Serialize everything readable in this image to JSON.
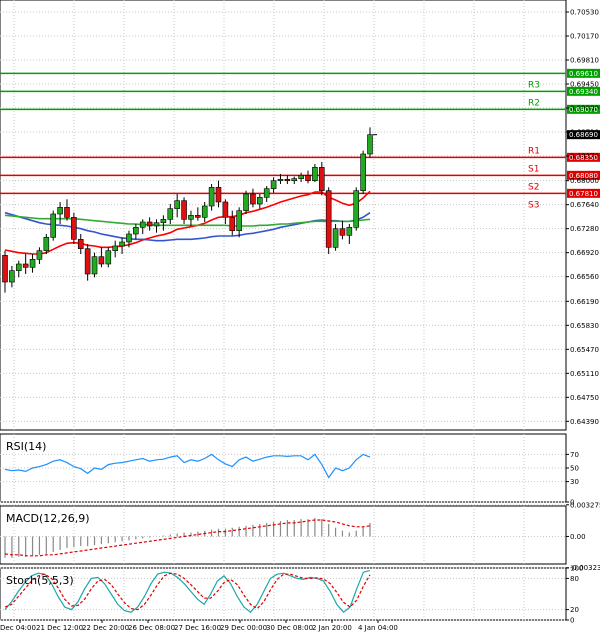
{
  "chart_data": [
    {
      "type": "candlestick",
      "panel": "price",
      "ylim": [
        0.6426,
        0.7071
      ],
      "y_ticks": [
        0.7053,
        0.7017,
        0.6981,
        0.6945,
        0.6909,
        0.6873,
        0.6837,
        0.68,
        0.6764,
        0.6728,
        0.6692,
        0.6656,
        0.6619,
        0.6583,
        0.6547,
        0.6511,
        0.6475,
        0.6439
      ],
      "y_tick_labels": [
        "0.70530",
        "0.70170",
        "0.69810",
        "0.69450",
        "0.69090",
        "0.68730",
        "0.68370",
        "0.68000",
        "0.67640",
        "0.67280",
        "0.66920",
        "0.66560",
        "0.66190",
        "0.65830",
        "0.65470",
        "0.65110",
        "0.64750",
        "0.64390"
      ],
      "x_labels": [
        "Dec 04:00",
        "21 Dec 12:00",
        "22 Dec 20:00",
        "26 Dec 08:00",
        "27 Dec 16:00",
        "29 Dec 00:00",
        "30 Dec 08:00",
        "2 Jan 20:00",
        "4 Jan 04:00"
      ],
      "candles": [
        {
          "o": 0.6688,
          "h": 0.6695,
          "l": 0.6632,
          "c": 0.6648
        },
        {
          "o": 0.6648,
          "h": 0.6672,
          "l": 0.664,
          "c": 0.6665
        },
        {
          "o": 0.6665,
          "h": 0.668,
          "l": 0.6655,
          "c": 0.6675
        },
        {
          "o": 0.6675,
          "h": 0.669,
          "l": 0.666,
          "c": 0.667
        },
        {
          "o": 0.667,
          "h": 0.669,
          "l": 0.6662,
          "c": 0.6682
        },
        {
          "o": 0.6682,
          "h": 0.67,
          "l": 0.6675,
          "c": 0.6695
        },
        {
          "o": 0.6695,
          "h": 0.672,
          "l": 0.669,
          "c": 0.6715
        },
        {
          "o": 0.6715,
          "h": 0.6755,
          "l": 0.671,
          "c": 0.675
        },
        {
          "o": 0.675,
          "h": 0.6768,
          "l": 0.6735,
          "c": 0.676
        },
        {
          "o": 0.676,
          "h": 0.6772,
          "l": 0.674,
          "c": 0.6745
        },
        {
          "o": 0.6745,
          "h": 0.6752,
          "l": 0.6705,
          "c": 0.6712
        },
        {
          "o": 0.6712,
          "h": 0.672,
          "l": 0.669,
          "c": 0.6698
        },
        {
          "o": 0.6698,
          "h": 0.6705,
          "l": 0.665,
          "c": 0.666
        },
        {
          "o": 0.666,
          "h": 0.6692,
          "l": 0.6655,
          "c": 0.6686
        },
        {
          "o": 0.6686,
          "h": 0.67,
          "l": 0.667,
          "c": 0.6675
        },
        {
          "o": 0.6675,
          "h": 0.67,
          "l": 0.667,
          "c": 0.6695
        },
        {
          "o": 0.6695,
          "h": 0.671,
          "l": 0.6685,
          "c": 0.6702
        },
        {
          "o": 0.6702,
          "h": 0.6715,
          "l": 0.669,
          "c": 0.6708
        },
        {
          "o": 0.6708,
          "h": 0.6725,
          "l": 0.67,
          "c": 0.672
        },
        {
          "o": 0.672,
          "h": 0.6735,
          "l": 0.6712,
          "c": 0.673
        },
        {
          "o": 0.673,
          "h": 0.6742,
          "l": 0.672,
          "c": 0.6738
        },
        {
          "o": 0.6738,
          "h": 0.6745,
          "l": 0.6725,
          "c": 0.6732
        },
        {
          "o": 0.6732,
          "h": 0.6742,
          "l": 0.6722,
          "c": 0.6737
        },
        {
          "o": 0.6737,
          "h": 0.6748,
          "l": 0.6725,
          "c": 0.6742
        },
        {
          "o": 0.6742,
          "h": 0.6765,
          "l": 0.6735,
          "c": 0.6758
        },
        {
          "o": 0.6758,
          "h": 0.678,
          "l": 0.6745,
          "c": 0.677
        },
        {
          "o": 0.677,
          "h": 0.6775,
          "l": 0.6735,
          "c": 0.6742
        },
        {
          "o": 0.6742,
          "h": 0.6755,
          "l": 0.6732,
          "c": 0.6748
        },
        {
          "o": 0.6748,
          "h": 0.676,
          "l": 0.674,
          "c": 0.6745
        },
        {
          "o": 0.6745,
          "h": 0.6768,
          "l": 0.6738,
          "c": 0.6762
        },
        {
          "o": 0.6762,
          "h": 0.6795,
          "l": 0.6755,
          "c": 0.679
        },
        {
          "o": 0.679,
          "h": 0.68,
          "l": 0.676,
          "c": 0.6768
        },
        {
          "o": 0.6768,
          "h": 0.6772,
          "l": 0.6735,
          "c": 0.6745
        },
        {
          "o": 0.6745,
          "h": 0.6755,
          "l": 0.6718,
          "c": 0.6725
        },
        {
          "o": 0.6725,
          "h": 0.676,
          "l": 0.6715,
          "c": 0.6755
        },
        {
          "o": 0.6755,
          "h": 0.6785,
          "l": 0.675,
          "c": 0.678
        },
        {
          "o": 0.678,
          "h": 0.6788,
          "l": 0.676,
          "c": 0.6765
        },
        {
          "o": 0.6765,
          "h": 0.678,
          "l": 0.6758,
          "c": 0.6775
        },
        {
          "o": 0.6775,
          "h": 0.6792,
          "l": 0.6768,
          "c": 0.6788
        },
        {
          "o": 0.6788,
          "h": 0.6805,
          "l": 0.6782,
          "c": 0.68
        },
        {
          "o": 0.68,
          "h": 0.681,
          "l": 0.6795,
          "c": 0.6802
        },
        {
          "o": 0.6802,
          "h": 0.6808,
          "l": 0.6795,
          "c": 0.68
        },
        {
          "o": 0.68,
          "h": 0.6806,
          "l": 0.6795,
          "c": 0.6803
        },
        {
          "o": 0.6803,
          "h": 0.6812,
          "l": 0.6798,
          "c": 0.6808
        },
        {
          "o": 0.6808,
          "h": 0.6815,
          "l": 0.6796,
          "c": 0.68
        },
        {
          "o": 0.68,
          "h": 0.6825,
          "l": 0.6798,
          "c": 0.682
        },
        {
          "o": 0.682,
          "h": 0.6828,
          "l": 0.6778,
          "c": 0.6785
        },
        {
          "o": 0.6785,
          "h": 0.679,
          "l": 0.669,
          "c": 0.67
        },
        {
          "o": 0.67,
          "h": 0.6735,
          "l": 0.6695,
          "c": 0.6728
        },
        {
          "o": 0.6728,
          "h": 0.674,
          "l": 0.6712,
          "c": 0.6718
        },
        {
          "o": 0.6718,
          "h": 0.6735,
          "l": 0.6705,
          "c": 0.673
        },
        {
          "o": 0.673,
          "h": 0.679,
          "l": 0.6725,
          "c": 0.6785
        },
        {
          "o": 0.6785,
          "h": 0.6845,
          "l": 0.678,
          "c": 0.684
        },
        {
          "o": 0.684,
          "h": 0.688,
          "l": 0.6835,
          "c": 0.6869
        }
      ],
      "moving_averages": [
        {
          "color": "#ff0000",
          "values": [
            0.6696,
            0.6694,
            0.6692,
            0.6691,
            0.669,
            0.669,
            0.6692,
            0.6697,
            0.6702,
            0.6706,
            0.6707,
            0.6706,
            0.6703,
            0.6702,
            0.67,
            0.67,
            0.6701,
            0.6702,
            0.6704,
            0.6707,
            0.6711,
            0.6714,
            0.6717,
            0.6719,
            0.6722,
            0.6727,
            0.6729,
            0.6731,
            0.6733,
            0.6736,
            0.6741,
            0.6745,
            0.6746,
            0.6746,
            0.6748,
            0.6752,
            0.6754,
            0.6757,
            0.676,
            0.6764,
            0.6768,
            0.6771,
            0.6774,
            0.6777,
            0.6779,
            0.6783,
            0.6783,
            0.6775,
            0.6771,
            0.6766,
            0.6763,
            0.6766,
            0.6774,
            0.6784
          ]
        },
        {
          "color": "#3355cc",
          "values": [
            0.6752,
            0.6749,
            0.6746,
            0.6743,
            0.674,
            0.6737,
            0.6735,
            0.6734,
            0.6733,
            0.6732,
            0.673,
            0.6728,
            0.6725,
            0.6723,
            0.672,
            0.6718,
            0.6716,
            0.6714,
            0.6713,
            0.6712,
            0.6712,
            0.6711,
            0.671,
            0.671,
            0.6711,
            0.6712,
            0.6712,
            0.6712,
            0.6713,
            0.6714,
            0.6716,
            0.6717,
            0.6717,
            0.6717,
            0.6718,
            0.672,
            0.6721,
            0.6723,
            0.6725,
            0.6727,
            0.673,
            0.6732,
            0.6734,
            0.6736,
            0.6738,
            0.674,
            0.6741,
            0.674,
            0.674,
            0.6739,
            0.6739,
            0.6741,
            0.6745,
            0.6752
          ]
        },
        {
          "color": "#33aa33",
          "values": [
            0.6748,
            0.6747,
            0.6746,
            0.6745,
            0.6744,
            0.6743,
            0.6743,
            0.6743,
            0.6743,
            0.6743,
            0.6743,
            0.6742,
            0.6741,
            0.674,
            0.6739,
            0.6738,
            0.6737,
            0.6736,
            0.6735,
            0.6735,
            0.6734,
            0.6734,
            0.6733,
            0.6733,
            0.6733,
            0.6733,
            0.6733,
            0.6733,
            0.6733,
            0.6733,
            0.6733,
            0.6733,
            0.6733,
            0.6732,
            0.6732,
            0.6732,
            0.6732,
            0.6733,
            0.6733,
            0.6734,
            0.6735,
            0.6735,
            0.6736,
            0.6737,
            0.6738,
            0.6739,
            0.6739,
            0.6739,
            0.6739,
            0.6739,
            0.6739,
            0.674,
            0.6741,
            0.6742
          ]
        }
      ],
      "levels": [
        {
          "label": "",
          "value": 0.6961,
          "value_label": "0.69610",
          "color": "#00a000"
        },
        {
          "label": "R3",
          "value": 0.6934,
          "value_label": "0.69340",
          "color": "#00a000"
        },
        {
          "label": "R2",
          "value": 0.6907,
          "value_label": "0.69070",
          "color": "#00a000"
        },
        {
          "label": "R1",
          "value": 0.6835,
          "value_label": "0.68350",
          "color": "#e00000"
        },
        {
          "label": "S1",
          "value": 0.6808,
          "value_label": "0.68080",
          "color": "#e00000"
        },
        {
          "label": "S2",
          "value": 0.6781,
          "value_label": "0.67810",
          "color": "#e00000"
        },
        {
          "label": "S3",
          "value": null,
          "value_label": "",
          "color": "#e00000"
        }
      ],
      "current_price": {
        "value": 0.6869,
        "label": "0.68690"
      }
    },
    {
      "type": "line",
      "panel": "rsi",
      "title": "RSI(14)",
      "ylim": [
        0,
        100
      ],
      "y_ticks": [
        70,
        50,
        30,
        0
      ],
      "y_tick_labels": [
        "70",
        "50",
        "30",
        "0"
      ],
      "series": [
        {
          "color": "#1e90ff",
          "values": [
            48,
            46,
            47,
            45,
            50,
            52,
            55,
            60,
            62,
            58,
            52,
            49,
            42,
            50,
            48,
            55,
            57,
            58,
            60,
            62,
            64,
            60,
            62,
            63,
            66,
            68,
            58,
            62,
            60,
            64,
            70,
            62,
            56,
            52,
            62,
            66,
            60,
            63,
            66,
            68,
            68,
            67,
            68,
            68,
            62,
            70,
            55,
            36,
            50,
            46,
            50,
            62,
            70,
            66
          ]
        }
      ]
    },
    {
      "type": "bar+line",
      "panel": "macd",
      "title": "MACD(12,26,9)",
      "ylim": [
        -0.00285,
        0.00315
      ],
      "y_ticks": [
        0.003275,
        0.0,
        -0.003234
      ],
      "y_tick_labels": [
        "0.003275",
        "0.00",
        "-0.003234"
      ],
      "series": [
        {
          "name": "MACD",
          "kind": "bar",
          "color": "#888888",
          "values": [
            -0.0022,
            -0.0022,
            -0.0021,
            -0.0021,
            -0.002,
            -0.0019,
            -0.0018,
            -0.0016,
            -0.0014,
            -0.0012,
            -0.0011,
            -0.001,
            -0.001,
            -0.0009,
            -0.0008,
            -0.0007,
            -0.0006,
            -0.0005,
            -0.0004,
            -0.0003,
            -0.0002,
            -0.0001,
            0.0,
            0.0001,
            0.0002,
            0.0003,
            0.0004,
            0.0004,
            0.0005,
            0.0006,
            0.0007,
            0.0008,
            0.0008,
            0.0009,
            0.001,
            0.0011,
            0.0012,
            0.0013,
            0.0014,
            0.0015,
            0.0016,
            0.0017,
            0.0017,
            0.0018,
            0.0018,
            0.0019,
            0.0018,
            0.0013,
            0.0009,
            0.0006,
            0.0004,
            0.0006,
            0.001,
            0.0014
          ]
        },
        {
          "name": "Signal",
          "kind": "line",
          "color": "#e00000",
          "values": [
            -0.0018,
            -0.0019,
            -0.0019,
            -0.002,
            -0.002,
            -0.002,
            -0.0019,
            -0.0019,
            -0.0018,
            -0.0017,
            -0.0016,
            -0.0015,
            -0.0014,
            -0.0013,
            -0.0012,
            -0.0011,
            -0.001,
            -0.0009,
            -0.0008,
            -0.0007,
            -0.0006,
            -0.0005,
            -0.0004,
            -0.0003,
            -0.0002,
            -0.0001,
            0.0,
            0.0001,
            0.0002,
            0.0003,
            0.0004,
            0.0005,
            0.0005,
            0.0006,
            0.0007,
            0.0008,
            0.0009,
            0.001,
            0.0011,
            0.0012,
            0.0013,
            0.0014,
            0.0014,
            0.0015,
            0.0016,
            0.0017,
            0.0017,
            0.0016,
            0.0015,
            0.0013,
            0.0011,
            0.001,
            0.001,
            0.0011
          ]
        }
      ]
    },
    {
      "type": "line",
      "panel": "stoch",
      "title": "Stoch(5,5,3)",
      "ylim": [
        0,
        100
      ],
      "y_ticks": [
        100,
        80,
        20,
        0
      ],
      "y_tick_labels": [
        "100",
        "80",
        "20",
        "0"
      ],
      "series": [
        {
          "name": "%K",
          "color": "#1aa8a8",
          "values": [
            20,
            35,
            55,
            72,
            85,
            90,
            88,
            70,
            45,
            25,
            20,
            35,
            60,
            80,
            82,
            70,
            50,
            30,
            18,
            15,
            25,
            45,
            70,
            88,
            92,
            90,
            82,
            70,
            55,
            40,
            30,
            50,
            75,
            85,
            70,
            45,
            25,
            15,
            30,
            55,
            80,
            88,
            90,
            85,
            80,
            78,
            82,
            80,
            75,
            55,
            30,
            15,
            25,
            60,
            92,
            95
          ]
        },
        {
          "name": "%D",
          "color": "#e00000",
          "values": [
            25,
            30,
            45,
            60,
            75,
            85,
            88,
            80,
            62,
            40,
            27,
            28,
            40,
            60,
            75,
            78,
            68,
            50,
            33,
            22,
            20,
            30,
            48,
            68,
            85,
            90,
            88,
            80,
            68,
            55,
            42,
            42,
            55,
            72,
            78,
            68,
            48,
            30,
            22,
            35,
            58,
            78,
            88,
            88,
            84,
            80,
            80,
            81,
            79,
            70,
            53,
            34,
            25,
            38,
            65,
            87
          ]
        }
      ]
    }
  ]
}
